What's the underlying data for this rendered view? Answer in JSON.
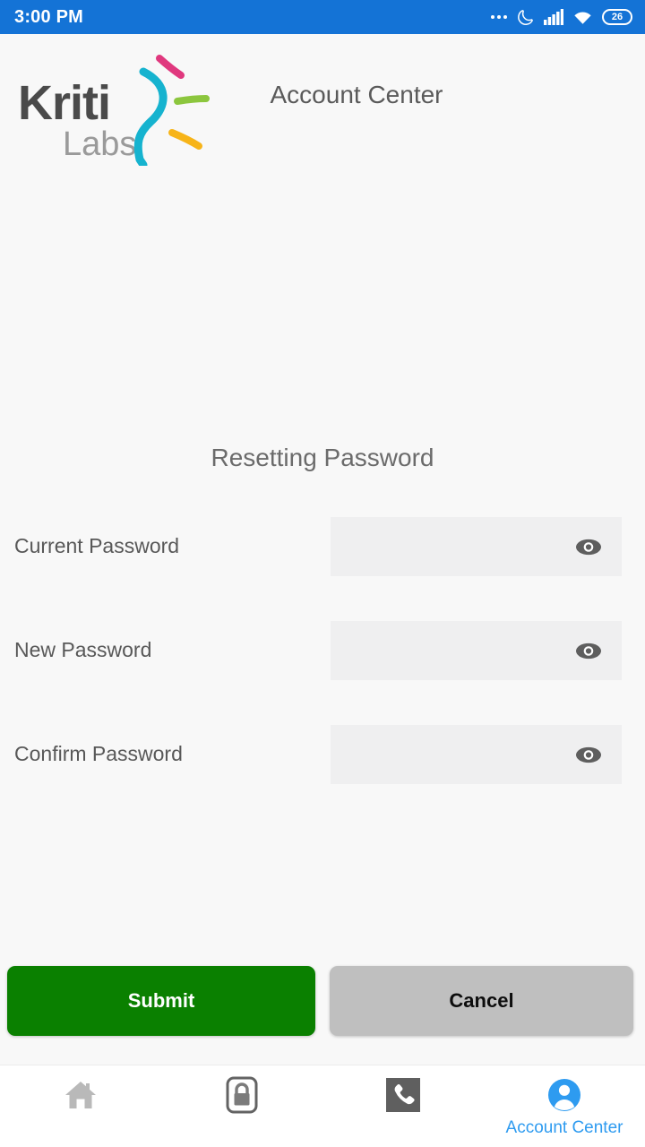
{
  "status_bar": {
    "time": "3:00 PM",
    "battery_level": "26",
    "icons": [
      "more-dots-icon",
      "do-not-disturb-moon-icon",
      "signal-bars-icon",
      "wifi-icon",
      "battery-icon"
    ],
    "background_color": "#1473d6"
  },
  "header": {
    "logo_primary": "Kriti",
    "logo_secondary": "Labs",
    "title": "Account Center"
  },
  "main": {
    "section_title": "Resetting Password",
    "fields": [
      {
        "label": "Current Password",
        "value": "",
        "placeholder": "",
        "toggle_icon": "eye-icon"
      },
      {
        "label": "New Password",
        "value": "",
        "placeholder": "",
        "toggle_icon": "eye-icon"
      },
      {
        "label": "Confirm Password",
        "value": "",
        "placeholder": "",
        "toggle_icon": "eye-icon"
      }
    ],
    "submit_label": "Submit",
    "cancel_label": "Cancel",
    "submit_color": "#0a8000",
    "cancel_color": "#bfbfbf"
  },
  "bottom_nav": {
    "active_color": "#2e9bf0",
    "items": [
      {
        "label": "",
        "icon": "home-icon",
        "active": false
      },
      {
        "label": "",
        "icon": "lock-icon",
        "active": false
      },
      {
        "label": "",
        "icon": "phone-icon",
        "active": false
      },
      {
        "label": "Account Center",
        "icon": "account-person-icon",
        "active": true
      }
    ]
  }
}
